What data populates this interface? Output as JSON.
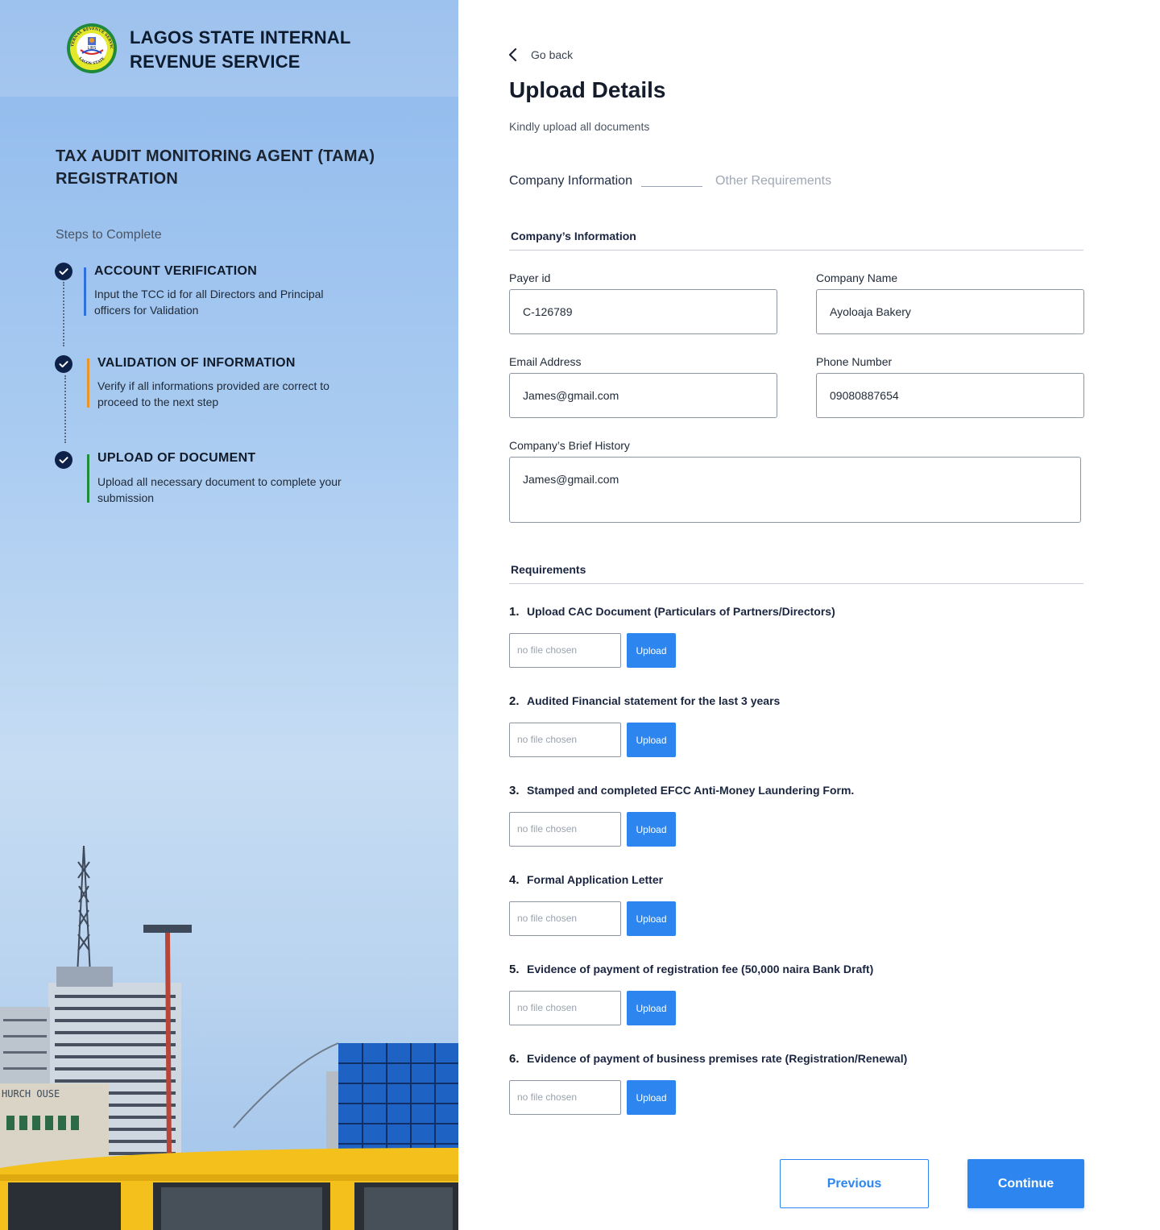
{
  "brand": {
    "line1": "LAGOS STATE INTERNAL",
    "line2": "REVENUE SERVICE",
    "logo_text": "LIRS",
    "logo_ring_top": "INTERNAL REVENUE SERVICE",
    "logo_ring_bottom": "LAGOS STATE"
  },
  "sidebar": {
    "title": "TAX AUDIT MONITORING AGENT (TAMA) REGISTRATION",
    "steps_label": "Steps to Complete",
    "steps": [
      {
        "title": "ACCOUNT VERIFICATION",
        "desc": "Input the TCC id for all Directors and Principal officers for Validation",
        "accent": "#2f6fe0"
      },
      {
        "title": "VALIDATION OF INFORMATION",
        "desc": "Verify if all informations provided are correct to proceed to the next step",
        "accent": "#e8962a"
      },
      {
        "title": "UPLOAD OF DOCUMENT",
        "desc": "Upload all necessary document to complete your submission",
        "accent": "#1e8c3a"
      }
    ],
    "scene_sign": "HURCH OUSE"
  },
  "header": {
    "go_back": "Go back",
    "title": "Upload Details",
    "subtitle": "Kindly upload all documents"
  },
  "tabs": {
    "active": "Company Information",
    "inactive": "Other Requirements"
  },
  "company": {
    "section_title": "Company’s Information",
    "payer_id_label": "Payer id",
    "payer_id_value": "C-126789",
    "company_name_label": "Company Name",
    "company_name_value": "Ayoloaja Bakery",
    "email_label": "Email Address",
    "email_value": "James@gmail.com",
    "phone_label": "Phone Number",
    "phone_value": "09080887654",
    "history_label": "Company’s Brief History",
    "history_value": "James@gmail.com"
  },
  "requirements": {
    "section_title": "Requirements",
    "file_placeholder": "no file chosen",
    "upload_label": "Upload",
    "items": [
      {
        "num": "1.",
        "text": "Upload CAC Document (Particulars of Partners/Directors)"
      },
      {
        "num": "2.",
        "text": "Audited Financial statement for the last 3 years"
      },
      {
        "num": "3.",
        "text": "Stamped and completed EFCC Anti-Money Laundering Form."
      },
      {
        "num": "4.",
        "text": "Formal Application Letter"
      },
      {
        "num": "5.",
        "text": "Evidence of payment of registration fee (50,000 naira Bank Draft)"
      },
      {
        "num": "6.",
        "text": "Evidence of payment of business premises rate (Registration/Renewal)"
      }
    ]
  },
  "actions": {
    "previous": "Previous",
    "continue": "Continue"
  },
  "colors": {
    "primary": "#2d86f0",
    "navy": "#0e2148"
  }
}
